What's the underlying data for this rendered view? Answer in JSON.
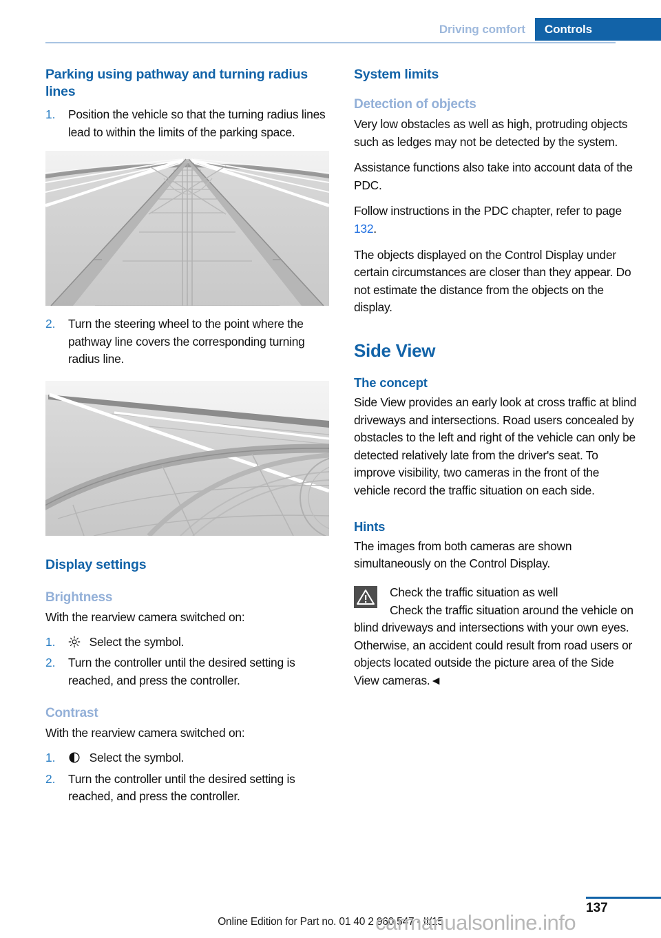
{
  "header": {
    "chapter": "Driving comfort",
    "section": "Controls"
  },
  "left_column": {
    "heading": "Parking using pathway and turning radius lines",
    "steps_parking": [
      {
        "num": "1.",
        "text": "Position the vehicle so that the turning radius lines lead to within the limits of the parking space."
      },
      {
        "num": "2.",
        "text": "Turn the steering wheel to the point where the pathway line covers the corresponding turning radius line."
      }
    ],
    "figure_1_name": "rearview-camera-pathway-lines-image",
    "figure_2_name": "rearview-camera-turning-radius-image",
    "display_settings_heading": "Display settings",
    "brightness": {
      "subheading": "Brightness",
      "intro": "With the rearview camera switched on:",
      "icon": "brightness-sun-icon",
      "steps": [
        {
          "num": "1.",
          "text": "Select the symbol."
        },
        {
          "num": "2.",
          "text": "Turn the controller until the desired setting is reached, and press the controller."
        }
      ]
    },
    "contrast": {
      "subheading": "Contrast",
      "intro": "With the rearview camera switched on:",
      "icon": "contrast-half-circle-icon",
      "steps": [
        {
          "num": "1.",
          "text": "Select the symbol."
        },
        {
          "num": "2.",
          "text": "Turn the controller until the desired setting is reached, and press the controller."
        }
      ]
    }
  },
  "right_column": {
    "system_limits_heading": "System limits",
    "detection_subheading": "Detection of objects",
    "detection_paragraphs": [
      "Very low obstacles as well as high, protruding objects such as ledges may not be detected by the system.",
      "Assistance functions also take into account data of the PDC."
    ],
    "pdc_reference": {
      "text_before": "Follow instructions in the PDC chapter, refer to page ",
      "page_link": "132",
      "text_after": "."
    },
    "control_display_paragraph": "The objects displayed on the Control Display under certain circumstances are closer than they appear. Do not estimate the distance from the objects on the display.",
    "side_view_heading": "Side View",
    "concept_subheading": "The concept",
    "concept_paragraph": "Side View provides an early look at cross traffic at blind driveways and intersections. Road users concealed by obstacles to the left and right of the vehicle can only be detected relatively late from the driver's seat. To improve visibility, two cameras in the front of the vehicle record the traffic situation on each side.",
    "hints_subheading": "Hints",
    "hints_paragraph": "The images from both cameras are shown simultaneously on the Control Display.",
    "warning": {
      "icon": "warning-triangle-icon",
      "title": "Check the traffic situation as well",
      "body": "Check the traffic situation around the vehicle on blind driveways and intersections with your own eyes. Otherwise, an accident could result from road users or objects located outside the picture area of the Side View cameras.◄"
    }
  },
  "footer": {
    "page_number": "137",
    "edition": "Online Edition for Part no. 01 40 2 960 547 - II/15",
    "watermark": "carmanualsonline.info"
  },
  "colors": {
    "heading_blue": "#1263a8",
    "light_blue": "#93b0d8",
    "tab_blue": "#1263a8",
    "link_blue": "#1f6fe0",
    "rule_blue": "#a8c4e2"
  }
}
